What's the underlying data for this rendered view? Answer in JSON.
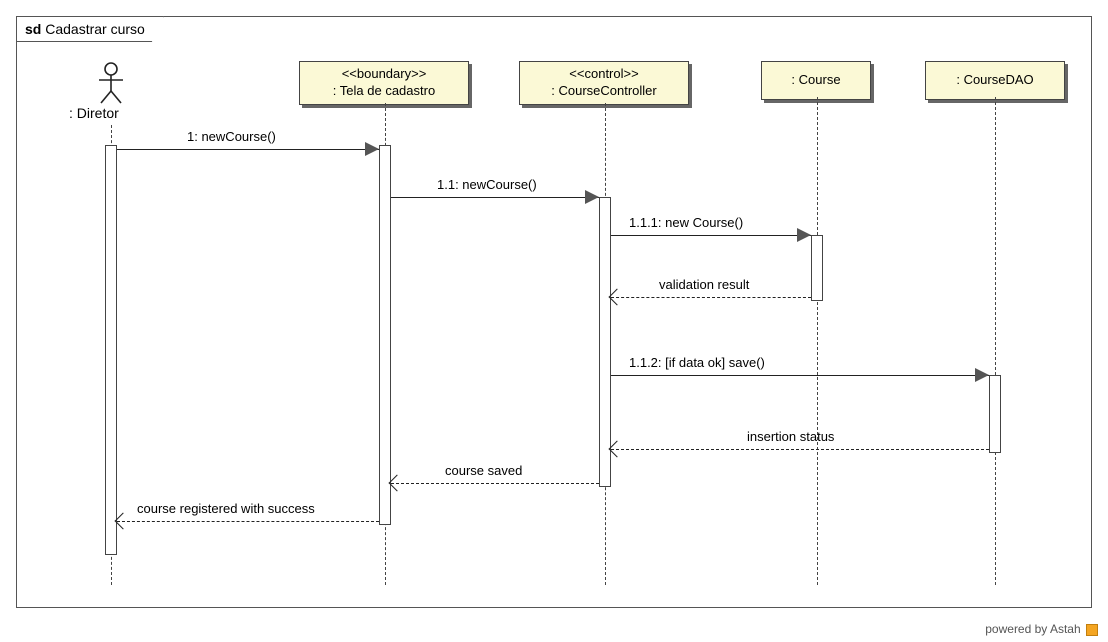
{
  "frame": {
    "prefix": "sd",
    "title": "Cadastrar curso"
  },
  "actors": {
    "diretor": {
      "label": ": Diretor"
    }
  },
  "lifelines": {
    "tela": {
      "stereotype": "<<boundary>>",
      "name": ": Tela de cadastro"
    },
    "controller": {
      "stereotype": "<<control>>",
      "name": ": CourseController"
    },
    "course": {
      "name": ": Course"
    },
    "dao": {
      "name": ": CourseDAO"
    }
  },
  "messages": {
    "m1": "1: newCourse()",
    "m11": "1.1: newCourse()",
    "m111": "1.1.1: new Course()",
    "r111": "validation result",
    "m112": "1.1.2: [if data ok] save()",
    "r112": "insertion status",
    "r11": "course saved",
    "r1": "course registered with success"
  },
  "footer": "powered by Astah",
  "chart_data": {
    "type": "uml_sequence_diagram",
    "frame": "sd Cadastrar curso",
    "participants": [
      {
        "id": "diretor",
        "kind": "actor",
        "name": "Diretor"
      },
      {
        "id": "tela",
        "kind": "boundary",
        "name": "Tela de cadastro"
      },
      {
        "id": "controller",
        "kind": "control",
        "name": "CourseController"
      },
      {
        "id": "course",
        "kind": "object",
        "name": "Course"
      },
      {
        "id": "dao",
        "kind": "object",
        "name": "CourseDAO"
      }
    ],
    "messages": [
      {
        "seq": "1",
        "from": "diretor",
        "to": "tela",
        "label": "newCourse()",
        "type": "sync"
      },
      {
        "seq": "1.1",
        "from": "tela",
        "to": "controller",
        "label": "newCourse()",
        "type": "sync"
      },
      {
        "seq": "1.1.1",
        "from": "controller",
        "to": "course",
        "label": "new Course()",
        "type": "sync"
      },
      {
        "seq": "",
        "from": "course",
        "to": "controller",
        "label": "validation result",
        "type": "return"
      },
      {
        "seq": "1.1.2",
        "from": "controller",
        "to": "dao",
        "label": "[if data ok] save()",
        "type": "sync"
      },
      {
        "seq": "",
        "from": "dao",
        "to": "controller",
        "label": "insertion status",
        "type": "return"
      },
      {
        "seq": "",
        "from": "controller",
        "to": "tela",
        "label": "course saved",
        "type": "return"
      },
      {
        "seq": "",
        "from": "tela",
        "to": "diretor",
        "label": "course registered with success",
        "type": "return"
      }
    ]
  }
}
